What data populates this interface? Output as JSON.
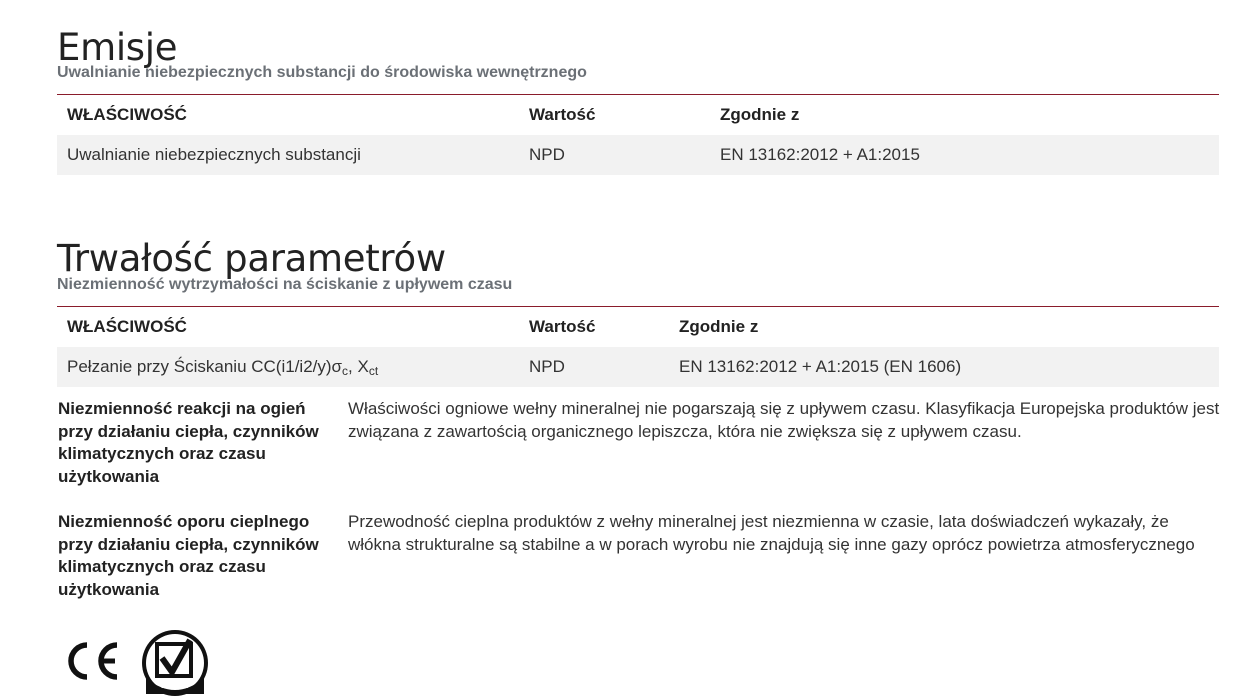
{
  "sections": {
    "emisje": {
      "title": "Emisje",
      "subtitle": "Uwalnianie niebezpiecznych substancji do środowiska wewnętrznego",
      "table": {
        "headers": [
          "WŁAŚCIWOŚĆ",
          "Wartość",
          "Zgodnie z"
        ],
        "rows": [
          [
            "Uwalnianie niebezpiecznych substancji",
            "NPD",
            "EN 13162:2012 + A1:2015"
          ]
        ]
      }
    },
    "trwalosc": {
      "title": "Trwałość parametrów",
      "subtitle": "Niezmienność wytrzymałości na ściskanie z upływem czasu",
      "table": {
        "headers": [
          "WŁAŚCIWOŚĆ",
          "Wartość",
          "Zgodnie z"
        ],
        "rows": [
          {
            "property_main": "Pełzanie przy Ściskaniu CC(i1/i2/y)σ",
            "property_sub1": "c",
            "property_mid": ", X",
            "property_sub2": "ct",
            "value": "NPD",
            "standard": "EN 13162:2012 + A1:2015 (EN 1606)"
          }
        ]
      }
    }
  },
  "definitions": [
    {
      "term": "Niezmienność reakcji na ogień przy działaniu ciepła, czynników klimatycznych oraz czasu użytkowania",
      "description": "Właściwości ogniowe wełny mineralnej nie pogarszają się z upływem czasu. Klasyfikacja Europejska produktów jest związana z zawartością organicznego lepiszcza, która nie zwiększa się z upływem czasu."
    },
    {
      "term": "Niezmienność oporu cieplnego przy działaniu ciepła, czynników klimatycznych oraz czasu użytkowania",
      "description": "Przewodność cieplna produktów z wełny mineralnej jest niezmienna w czasie, lata doświadczeń wykazały, że włókna strukturalne są stabilne a w porach wyrobu nie znajdują się inne gazy oprócz powietrza atmosferycznego"
    }
  ],
  "logos": {
    "ce": {
      "icon": "ce-mark-icon",
      "text": "CE"
    },
    "euceb": {
      "icon": "euceb-checkmark-icon",
      "text": "EUCEB"
    }
  },
  "colors": {
    "table_rule": "#8a1c2b",
    "subtitle": "#6b7076",
    "row_shade": "#f2f2f2"
  }
}
